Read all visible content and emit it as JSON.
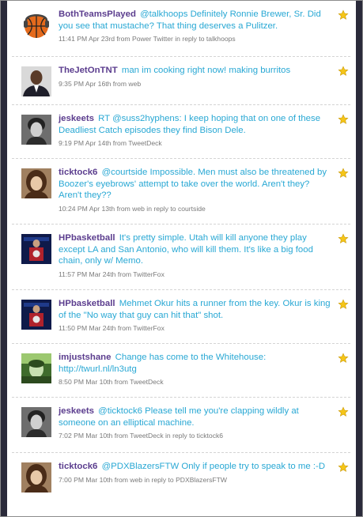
{
  "colors": {
    "username": "#5b3d8e",
    "tweet_text": "#29a8d4",
    "meta_text": "#7a7a7a",
    "star": "#f5c518",
    "frame_side": "#2a2a3a"
  },
  "tweets": [
    {
      "avatar": "basketball-avatar",
      "username": "BothTeamsPlayed",
      "text": "@talkhoops Definitely Ronnie Brewer, Sr. Did you see that mustache? That thing deserves a Pulitzer.",
      "meta": "11:41 PM Apr 23rd from Power Twitter in reply to talkhoops"
    },
    {
      "avatar": "man-in-suit-avatar",
      "username": "TheJetOnTNT",
      "text": "man im cooking right now! making burritos",
      "meta": "9:35 PM Apr 16th from web"
    },
    {
      "avatar": "man-portrait-avatar",
      "username": "jeskeets",
      "text": "RT @suss2hyphens: I keep hoping that on one of these Deadliest Catch episodes they find Bison Dele.",
      "meta": "9:19 PM Apr 14th from TweetDeck"
    },
    {
      "avatar": "woman-portrait-avatar",
      "username": "ticktock6",
      "text": "@courtside Impossible. Men must also be threatened by Boozer's eyebrows' attempt to take over the world. Aren't they? Aren't they??",
      "meta": "10:24 PM Apr 13th from web in reply to courtside"
    },
    {
      "avatar": "hp-podium-avatar",
      "username": "HPbasketball",
      "text": "It's pretty simple. Utah will kill anyone they play except LA and San Antonio, who will kill them. It's like a big food chain, only w/ Memo.",
      "meta": "11:57 PM Mar 24th from TwitterFox"
    },
    {
      "avatar": "hp-podium-avatar",
      "username": "HPbasketball",
      "text": "Mehmet Okur hits a runner from the key. Okur is king of the \"No way that guy can hit that\" shot.",
      "meta": "11:50 PM Mar 24th from TwitterFox"
    },
    {
      "avatar": "green-poster-avatar",
      "username": "imjustshane",
      "text": "Change has come to the Whitehouse: http://twurl.nl/ln3utg",
      "meta": "8:50 PM Mar 10th from TweetDeck"
    },
    {
      "avatar": "man-portrait-avatar",
      "username": "jeskeets",
      "text": "@ticktock6 Please tell me you're clapping wildly at someone on an elliptical machine.",
      "meta": "7:02 PM Mar 10th from TweetDeck in reply to ticktock6"
    },
    {
      "avatar": "woman-portrait-avatar",
      "username": "ticktock6",
      "text": "@PDXBlazersFTW Only if people try to speak to me :-D",
      "meta": "7:00 PM Mar 10th from web in reply to PDXBlazersFTW"
    }
  ]
}
